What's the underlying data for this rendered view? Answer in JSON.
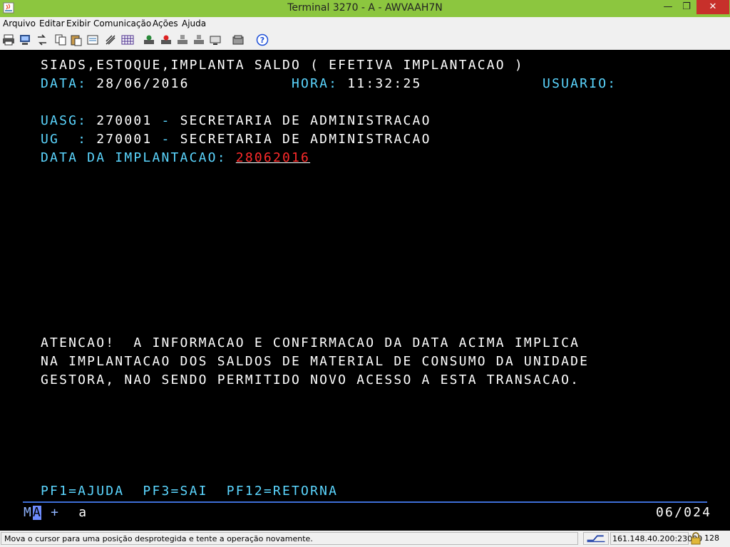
{
  "window": {
    "title": "Terminal 3270 - A - AWVAAH7N"
  },
  "menu": {
    "items": [
      "Arquivo",
      "Editar",
      "Exibir",
      "Comunicação",
      "Ações",
      "Ajuda"
    ]
  },
  "screen": {
    "header": "SIADS,ESTOQUE,IMPLANTA SALDO ( EFETIVA IMPLANTACAO )",
    "data_label": "DATA:",
    "data_value": "28/06/2016",
    "hora_label": "HORA:",
    "hora_value": "11:32:25",
    "usuario_label": "USUARIO:",
    "uasg_label": "UASG:",
    "uasg_value": "270001",
    "uasg_sep": "-",
    "uasg_name": "SECRETARIA DE ADMINISTRACAO",
    "ug_label": "UG  :",
    "ug_value": "270001",
    "ug_sep": "-",
    "ug_name": "SECRETARIA DE ADMINISTRACAO",
    "impl_label": "DATA DA IMPLANTACAO:",
    "impl_value": "28062016",
    "warning": [
      "ATENCAO!  A INFORMACAO E CONFIRMACAO DA DATA ACIMA IMPLICA",
      "NA IMPLANTACAO DOS SALDOS DE MATERIAL DE CONSUMO DA UNIDADE",
      "GESTORA, NAO SENDO PERMITIDO NOVO ACESSO A ESTA TRANSACAO."
    ],
    "pfkeys": "PF1=AJUDA  PF3=SAI  PF12=RETORNA"
  },
  "oia": {
    "left_a": "M",
    "left_b": "A",
    "plus": "+",
    "mode": "a",
    "cursor_pos": "06/024"
  },
  "status": {
    "message": "Mova o cursor para uma posição desprotegida e tente a operação novamente.",
    "host": "161.148.40.200:23000",
    "bits": "128"
  },
  "colors": {
    "titlebar": "#8cc63f",
    "terminal_bg": "#000000",
    "field_cyan": "#5bd6ff",
    "input_red": "#ff2a2a"
  }
}
